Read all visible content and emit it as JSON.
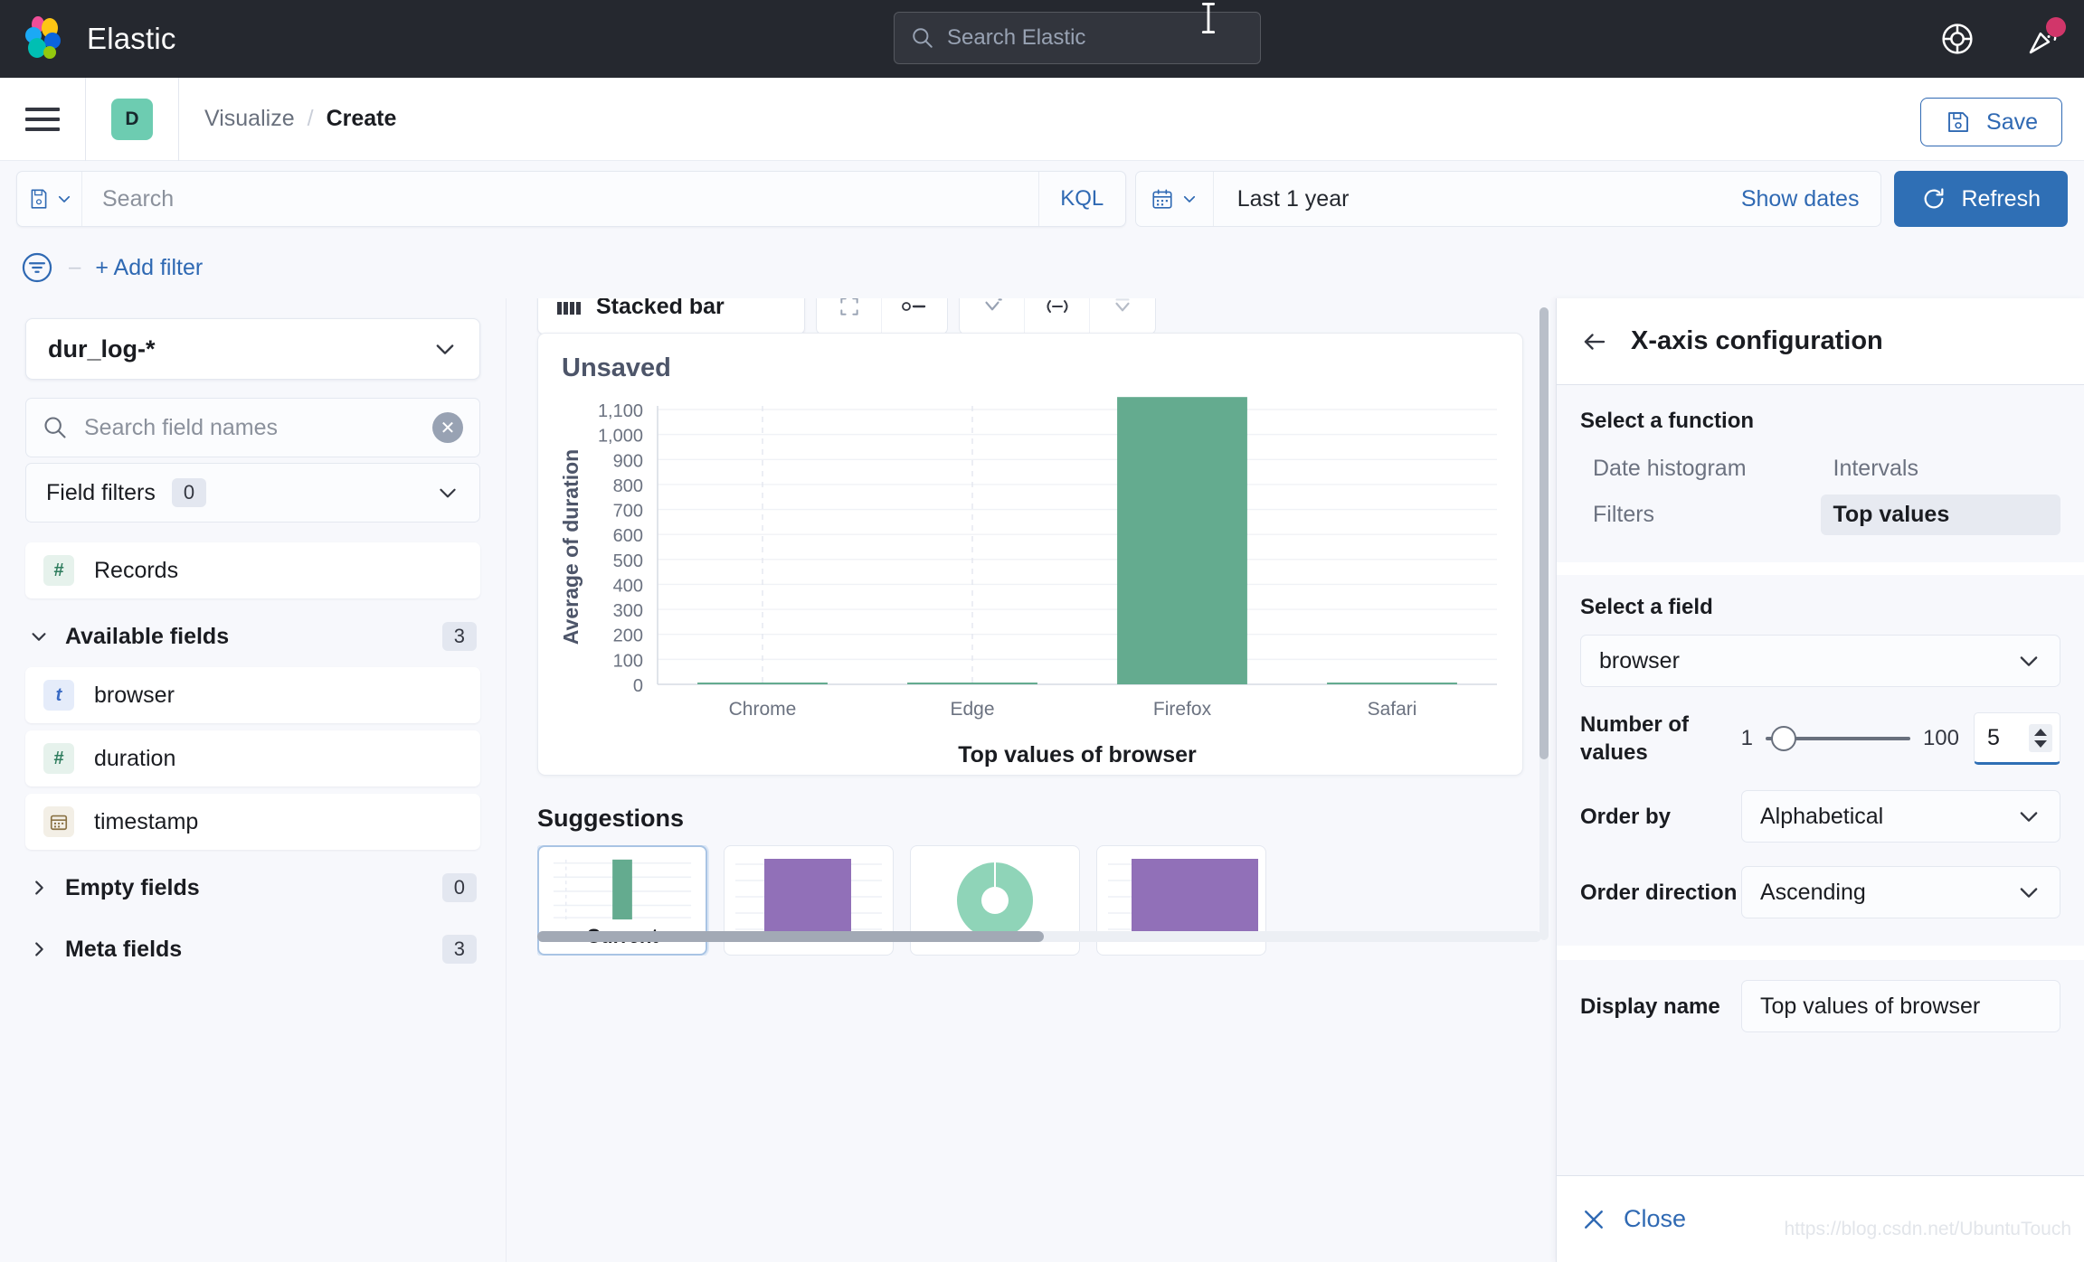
{
  "topbar": {
    "brand": "Elastic",
    "search_placeholder": "Search Elastic",
    "help_icon": "life-ring-icon",
    "news_icon": "party-popper-icon"
  },
  "breadcrumbbar": {
    "menu_icon": "hamburger-menu-icon",
    "space_initial": "D",
    "crumb_parent": "Visualize",
    "crumb_sep": "/",
    "crumb_current": "Create",
    "save_label": "Save",
    "save_icon": "floppy-disk-icon"
  },
  "querybar": {
    "saved_query_icon": "saved-query-icon",
    "search_placeholder": "Search",
    "language": "KQL",
    "calendar_icon": "calendar-icon",
    "time_range": "Last 1 year",
    "show_dates": "Show dates",
    "refresh_label": "Refresh",
    "refresh_icon": "refresh-icon"
  },
  "filterbar": {
    "filter_icon": "filter-funnel-icon",
    "add_filter": "+ Add filter"
  },
  "datapanel": {
    "datasource": "dur_log-*",
    "search_placeholder": "Search field names",
    "search_icon": "search-icon",
    "clear_icon": "clear-x-icon",
    "field_filters_label": "Field filters",
    "field_filters_count": "0",
    "records": {
      "label": "Records",
      "type": "number"
    },
    "available": {
      "label": "Available fields",
      "count": "3"
    },
    "fields": [
      {
        "label": "browser",
        "type": "string",
        "glyph": "t"
      },
      {
        "label": "duration",
        "type": "number",
        "glyph": "#"
      },
      {
        "label": "timestamp",
        "type": "date",
        "glyph": "calendar-icon"
      }
    ],
    "empty": {
      "label": "Empty fields",
      "count": "0"
    },
    "meta": {
      "label": "Meta fields",
      "count": "3"
    }
  },
  "workspace": {
    "chart_type": "Stacked bar",
    "chart_type_icon": "stacked-bar-icon",
    "toolbar_icons": [
      "chart-settings-icon",
      "legend-icon",
      "y-axis-icon",
      "x-axis-icon",
      "value-labels-icon"
    ],
    "chart_title": "Unsaved",
    "suggestions_label": "Suggestions",
    "suggestions": [
      {
        "label": "Current",
        "thumb": "bar",
        "color": "#6dccb1",
        "selected": true
      },
      {
        "label": "",
        "thumb": "area-purple",
        "color": "#9170b8",
        "selected": false
      },
      {
        "label": "",
        "thumb": "donut",
        "color": "#8fd4b8",
        "selected": false
      },
      {
        "label": "",
        "thumb": "area-purple-2",
        "color": "#9170b8",
        "selected": false
      }
    ]
  },
  "chart_data": {
    "type": "bar",
    "title": "Unsaved",
    "categories": [
      "Chrome",
      "Edge",
      "Firefox",
      "Safari"
    ],
    "values": [
      3,
      3,
      1150,
      3
    ],
    "series": [
      {
        "name": "Average of duration",
        "values": [
          3,
          3,
          1150,
          3
        ]
      }
    ],
    "xlabel": "Top values of browser",
    "ylabel": "Average of duration",
    "ylim": [
      0,
      1150
    ],
    "yticks": [
      "0",
      "100",
      "200",
      "300",
      "400",
      "500",
      "600",
      "700",
      "800",
      "900",
      "1,000",
      "1,100"
    ],
    "ytick_values": [
      0,
      100,
      200,
      300,
      400,
      500,
      600,
      700,
      800,
      900,
      1000,
      1100
    ],
    "bar_color": "#64ab8f",
    "grid": true,
    "legend": "none"
  },
  "configpanel": {
    "back_icon": "arrow-left-icon",
    "title": "X-axis configuration",
    "function_label": "Select a function",
    "functions": [
      {
        "label": "Date histogram",
        "selected": false
      },
      {
        "label": "Intervals",
        "selected": false
      },
      {
        "label": "Filters",
        "selected": false
      },
      {
        "label": "Top values",
        "selected": true
      }
    ],
    "field_label": "Select a field",
    "field_value": "browser",
    "number_of_values_label": "Number of values",
    "slider_min": "1",
    "slider_max": "100",
    "number_of_values": "5",
    "order_by_label": "Order by",
    "order_by_value": "Alphabetical",
    "order_direction_label": "Order direction",
    "order_direction_value": "Ascending",
    "display_name_label": "Display name",
    "display_name_value": "Top values of browser",
    "close_label": "Close",
    "close_icon": "close-x-icon"
  },
  "watermark": "https://blog.csdn.net/UbuntuTouch"
}
